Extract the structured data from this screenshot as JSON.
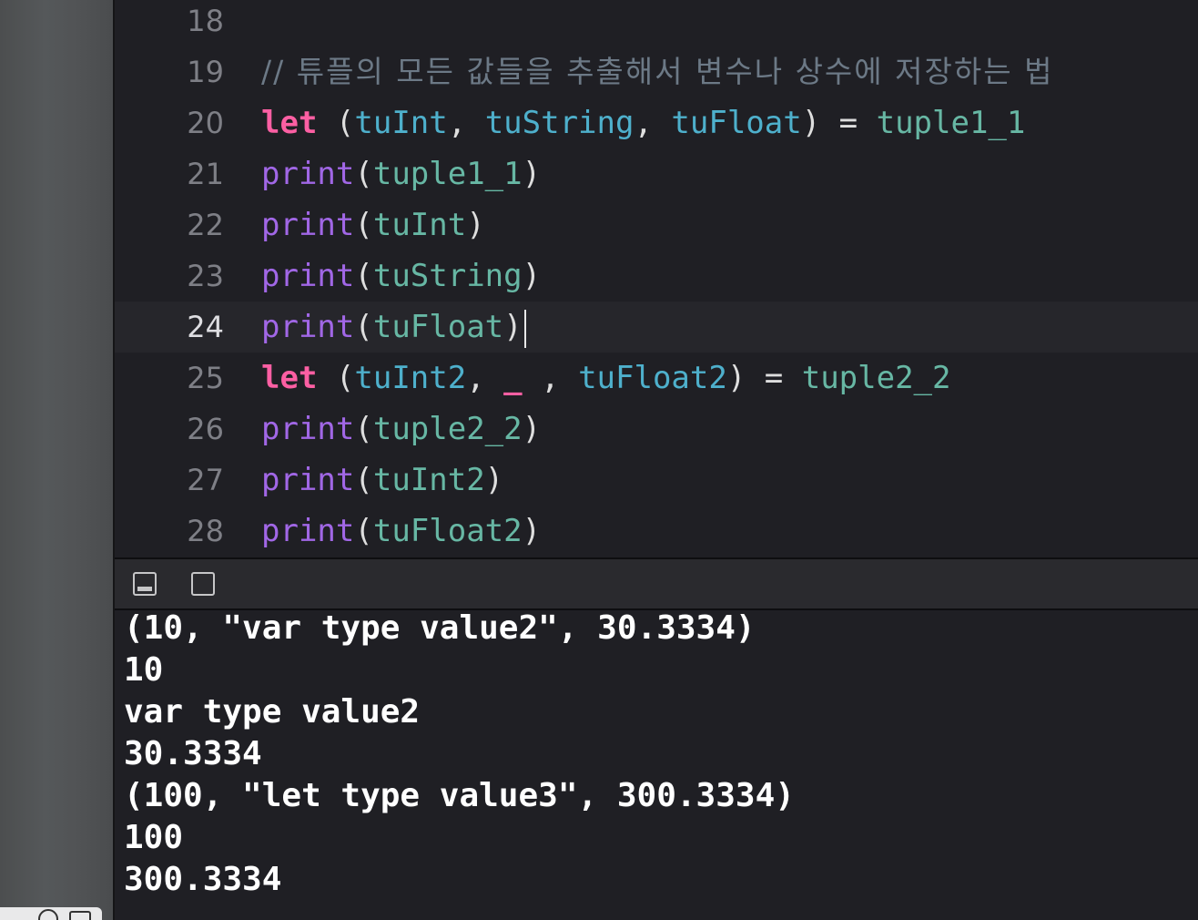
{
  "editor": {
    "current_line": "24",
    "lines": [
      {
        "num": "18"
      },
      {
        "num": "19",
        "comment": "// 튜플의 모든 값들을 추출해서 변수나 상수에 저장하는 법"
      },
      {
        "num": "20",
        "t": [
          "let",
          " (",
          "tuInt",
          ",",
          " tuString",
          ",",
          " tuFloat",
          ")",
          " = ",
          "tuple1_1"
        ]
      },
      {
        "num": "21",
        "t": [
          "print",
          "(",
          "tuple1_1",
          ")"
        ]
      },
      {
        "num": "22",
        "t": [
          "print",
          "(",
          "tuInt",
          ")"
        ]
      },
      {
        "num": "23",
        "t": [
          "print",
          "(",
          "tuString",
          ")"
        ]
      },
      {
        "num": "24",
        "t": [
          "print",
          "(",
          "tuFloat",
          ")"
        ]
      },
      {
        "num": "25",
        "t": [
          "let",
          " (",
          "tuInt2",
          ",",
          " _",
          " ,",
          " tuFloat2",
          ")",
          " = ",
          "tuple2_2"
        ]
      },
      {
        "num": "26",
        "t": [
          "print",
          "(",
          "tuple2_2",
          ")"
        ]
      },
      {
        "num": "27",
        "t": [
          "print",
          "(",
          "tuInt2",
          ")"
        ]
      },
      {
        "num": "28",
        "t": [
          "print",
          "(",
          "tuFloat2",
          ")"
        ]
      }
    ]
  },
  "console": {
    "output": [
      "(10, \"var type value2\", 30.3334)",
      "10",
      "var type value2",
      "30.3334",
      "(100, \"let type value3\", 300.3334)",
      "100",
      "300.3334"
    ]
  },
  "colors": {
    "background": "#1f1f24",
    "keyword": "#fc5fa3",
    "function": "#a167e6",
    "identifier": "#67b7a4",
    "variable": "#4eb0cc",
    "comment": "#6c7986",
    "plain": "#dedede"
  },
  "icons": {
    "hide_console": "hide-debug-area-icon",
    "split_view": "split-view-icon"
  }
}
